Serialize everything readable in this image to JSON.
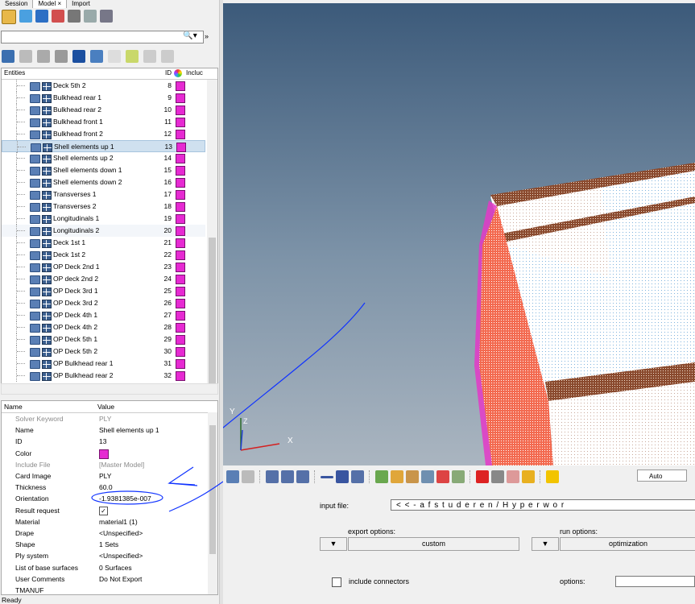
{
  "tabs": [
    "Session",
    "Model",
    "Import"
  ],
  "active_tab_close": "×",
  "search": {
    "placeholder": "",
    "button": "🔍▾",
    "more": "»"
  },
  "tree": {
    "header": {
      "entities": "Entities",
      "id": "ID",
      "include": "Incluc"
    },
    "rows": [
      {
        "name": "Deck 5th 2",
        "id": "8"
      },
      {
        "name": "Bulkhead rear 1",
        "id": "9"
      },
      {
        "name": "Bulkhead rear 2",
        "id": "10"
      },
      {
        "name": "Bulkhead front 1",
        "id": "11"
      },
      {
        "name": "Bulkhead front 2",
        "id": "12"
      },
      {
        "name": "Shell elements up 1",
        "id": "13"
      },
      {
        "name": "Shell elements up 2",
        "id": "14"
      },
      {
        "name": "Shell elements down 1",
        "id": "15"
      },
      {
        "name": "Shell elements down 2",
        "id": "16"
      },
      {
        "name": "Transverses 1",
        "id": "17"
      },
      {
        "name": "Transverses 2",
        "id": "18"
      },
      {
        "name": "Longitudinals 1",
        "id": "19"
      },
      {
        "name": "Longitudinals 2",
        "id": "20"
      },
      {
        "name": "Deck 1st 1",
        "id": "21"
      },
      {
        "name": "Deck 1st 2",
        "id": "22"
      },
      {
        "name": "OP Deck 2nd 1",
        "id": "23"
      },
      {
        "name": "OP deck 2nd 2",
        "id": "24"
      },
      {
        "name": "OP Deck 3rd 1",
        "id": "25"
      },
      {
        "name": "OP Deck 3rd 2",
        "id": "26"
      },
      {
        "name": "OP Deck 4th 1",
        "id": "27"
      },
      {
        "name": "OP Deck 4th 2",
        "id": "28"
      },
      {
        "name": "OP Deck 5th 1",
        "id": "29"
      },
      {
        "name": "OP Deck 5th 2",
        "id": "30"
      },
      {
        "name": "OP Bulkhead rear 1",
        "id": "31"
      },
      {
        "name": "OP Bulkhead rear 2",
        "id": "32"
      }
    ],
    "selected_index": 5,
    "highlight_index": 12,
    "color_swatch": "#e62ad2"
  },
  "props": {
    "header": {
      "name": "Name",
      "value": "Value"
    },
    "rows": [
      {
        "name": "Solver Keyword",
        "value": "PLY",
        "dim": true
      },
      {
        "name": "Name",
        "value": "Shell elements up 1"
      },
      {
        "name": "ID",
        "value": "13"
      },
      {
        "name": "Color",
        "value": ""
      },
      {
        "name": "Include File",
        "value": "[Master Model]",
        "dim": true
      },
      {
        "name": "Card Image",
        "value": "PLY"
      },
      {
        "name": "Thickness",
        "value": "60.0"
      },
      {
        "name": "Orientation",
        "value": "-1.9381385e-007"
      },
      {
        "name": "Result request",
        "value": "✓"
      },
      {
        "name": "Material",
        "value": "material1 (1)"
      },
      {
        "name": "Drape",
        "value": "<Unspecified>"
      },
      {
        "name": "Shape",
        "value": "1 Sets"
      },
      {
        "name": "Ply system",
        "value": "<Unspecified>"
      },
      {
        "name": "List of base surfaces",
        "value": "0 Surfaces"
      },
      {
        "name": "User Comments",
        "value": "Do Not Export"
      },
      {
        "name": "TMANUF",
        "value": ""
      }
    ]
  },
  "status": "Ready",
  "viewport": {
    "axis_y": "Y",
    "axis_z": "Z",
    "axis_x": "X"
  },
  "toolbar3": {
    "auto_label": "Auto"
  },
  "export_panel": {
    "input_file_label": "input file:",
    "input_file_value": "< < - a f s t u d e r e n / H y p e r w o r",
    "export_options_label": "export options:",
    "export_options_value": "custom",
    "run_options_label": "run options:",
    "run_options_value": "optimization",
    "include_connectors_label": "include connectors",
    "options_label": "options:"
  }
}
